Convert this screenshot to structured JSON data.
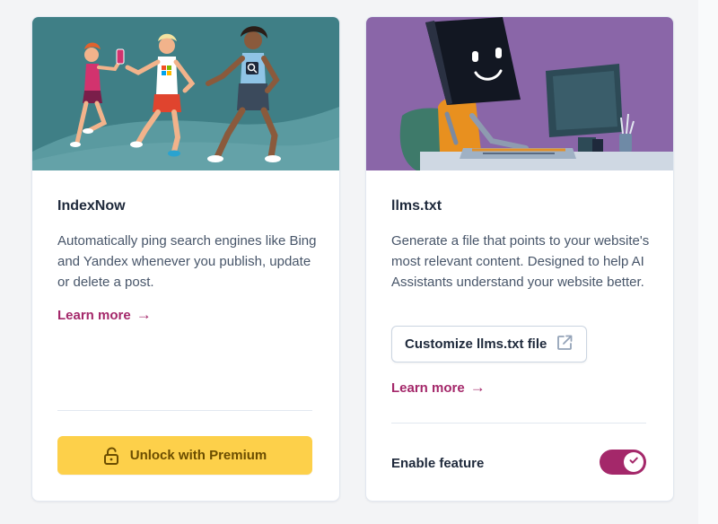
{
  "cards": [
    {
      "title": "IndexNow",
      "description": "Automatically ping search engines like Bing and Yandex whenever you publish, update or delete a post.",
      "learn_more": "Learn more",
      "learn_more_arrow": "→",
      "unlock_button": "Unlock with Premium",
      "unlock_icon": "lock-open-icon"
    },
    {
      "title": "llms.txt",
      "description": "Generate a file that points to your website's most relevant content. Designed to help AI Assistants understand your website better.",
      "customize_button": "Customize llms.txt file",
      "customize_icon": "external-link-icon",
      "learn_more": "Learn more",
      "learn_more_arrow": "→",
      "enable_label": "Enable feature",
      "enabled": true,
      "toggle_icon": "checkmark-icon"
    }
  ],
  "colors": {
    "accent": "#a4286a",
    "premium_yellow": "#fdd04a",
    "indexnow_hero_bg": "#3f7f86",
    "llms_hero_bg": "#8a66a8"
  }
}
